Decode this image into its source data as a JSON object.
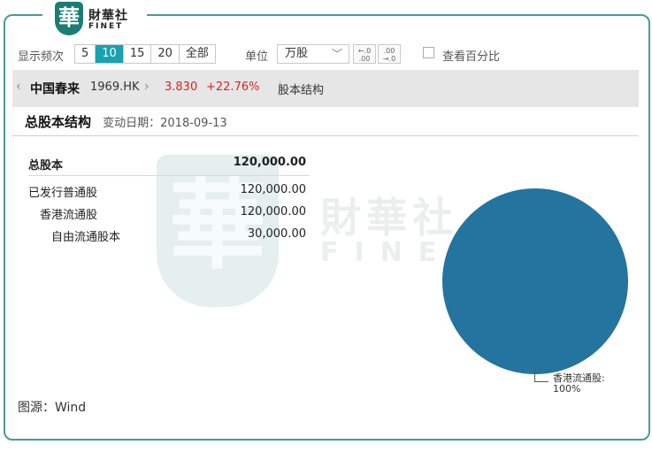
{
  "logo": {
    "mark": "華",
    "name_cn": "財華社",
    "name_en": "FINET"
  },
  "toolbar": {
    "frequency_label": "显示频次",
    "frequency_options": [
      "5",
      "10",
      "15",
      "20",
      "全部"
    ],
    "frequency_selected": "10",
    "unit_label": "单位",
    "unit_value": "万股",
    "decimal_add_icon": "decimal-increase-icon",
    "decimal_remove_icon": "decimal-decrease-icon",
    "decimal_add_text": "+.0\n.00",
    "decimal_remove_text": ".00\n.0",
    "percent_checkbox_label": "查看百分比",
    "percent_checked": false
  },
  "stock": {
    "name": "中国春来",
    "code": "1969.HK",
    "price": "3.830",
    "change": "+22.76%",
    "section": "股本结构",
    "change_color": "#d0281f"
  },
  "section": {
    "title": "总股本结构",
    "date_label": "变动日期",
    "date_value": "2018-09-13"
  },
  "table": {
    "total": {
      "label": "总股本",
      "value": "120,000.00"
    },
    "rows": [
      {
        "label": "已发行普通股",
        "value": "120,000.00",
        "level": 0
      },
      {
        "label": "香港流通股",
        "value": "120,000.00",
        "level": 1
      },
      {
        "label": "自由流通股本",
        "value": "30,000.00",
        "level": 2
      }
    ]
  },
  "chart_data": {
    "type": "pie",
    "slices": [
      {
        "name": "香港流通股",
        "value": 100,
        "color": "#23749f"
      }
    ],
    "labels": [
      {
        "line1": "香港流通股:",
        "line2": "100%"
      }
    ]
  },
  "watermark": {
    "mark": "華",
    "name_cn": "財華社",
    "name_en": "FINET"
  },
  "footer": {
    "source": "图源：Wind"
  },
  "colors": {
    "accent": "#16a2b0",
    "frame": "#4a9a95",
    "brand": "#1b7d74"
  }
}
